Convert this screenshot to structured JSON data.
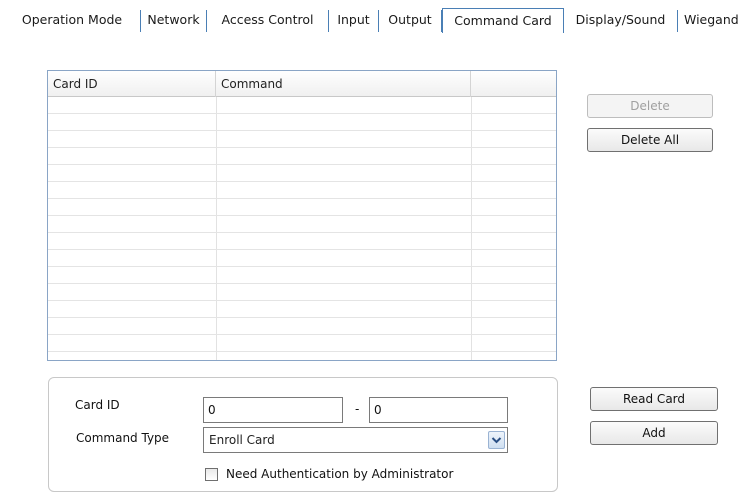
{
  "tabs": [
    {
      "label": "Operation Mode"
    },
    {
      "label": "Network"
    },
    {
      "label": "Access Control"
    },
    {
      "label": "Input"
    },
    {
      "label": "Output"
    },
    {
      "label": "Command Card"
    },
    {
      "label": "Display/Sound"
    },
    {
      "label": "Wiegand"
    }
  ],
  "active_tab": "Command Card",
  "table": {
    "columns": [
      "Card ID",
      "Command",
      ""
    ],
    "rows": []
  },
  "buttons": {
    "delete": "Delete",
    "delete_all": "Delete All",
    "read_card": "Read Card",
    "add": "Add"
  },
  "form": {
    "card_id_label": "Card ID",
    "card_id_from": "0",
    "card_id_separator": "-",
    "card_id_to": "0",
    "command_type_label": "Command Type",
    "command_type_value": "Enroll Card",
    "need_auth_label": "Need Authentication by Administrator",
    "need_auth_checked": false
  },
  "colors": {
    "tab_border": "#4a7fb5",
    "table_border": "#8aa5c6"
  }
}
